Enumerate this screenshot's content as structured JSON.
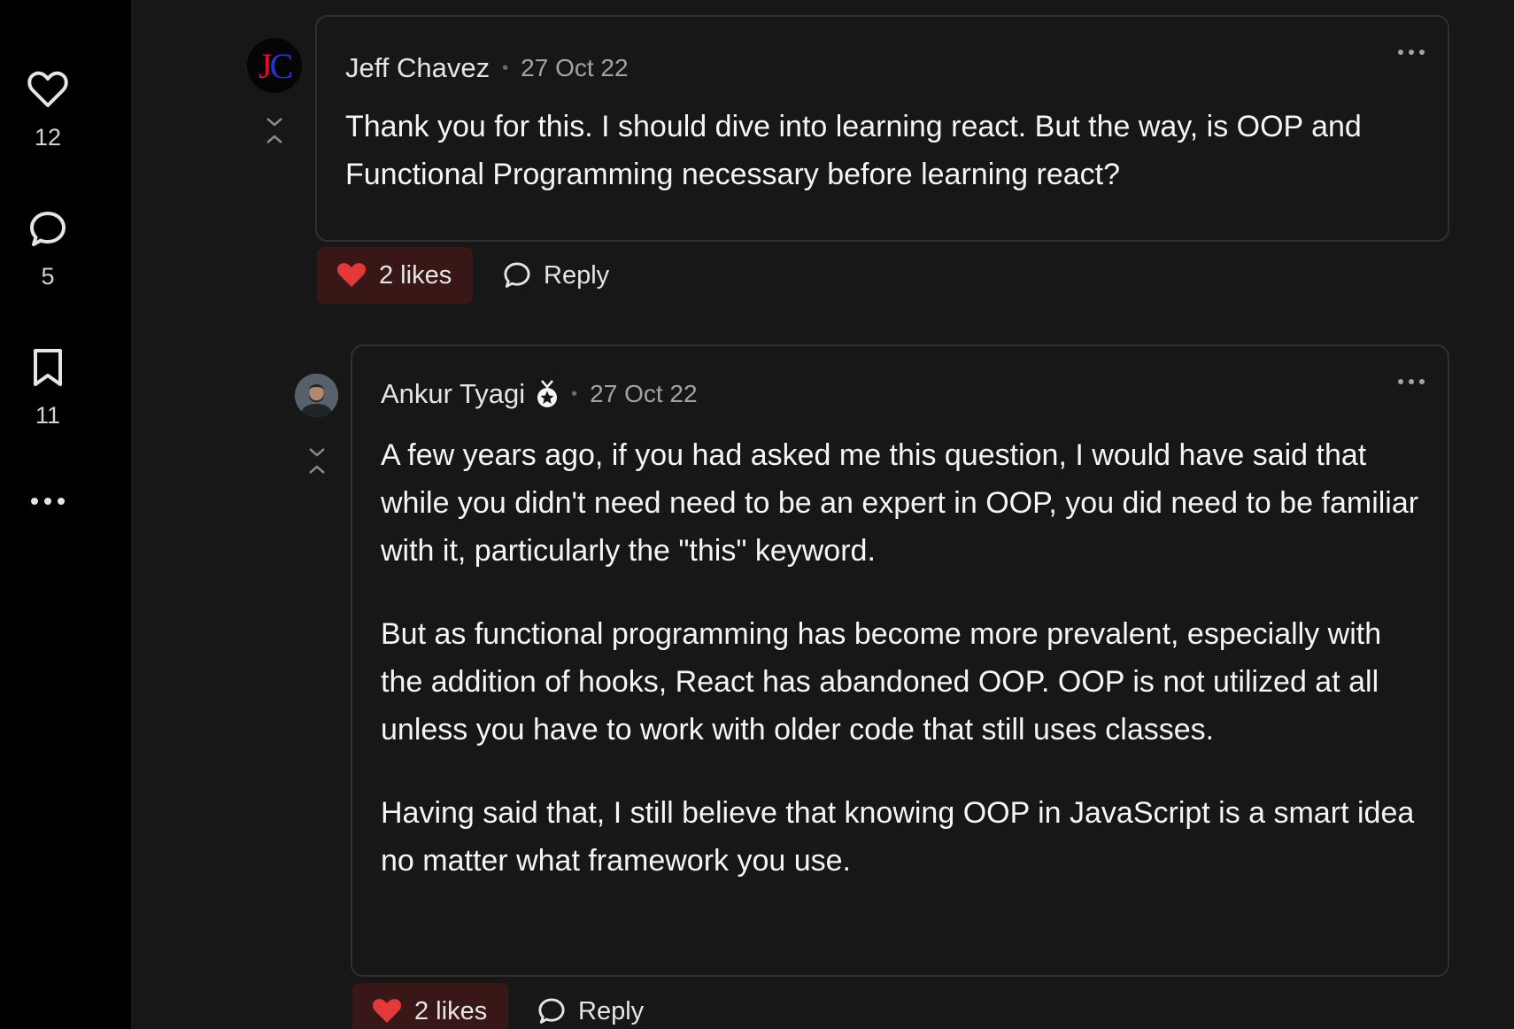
{
  "sidebar": {
    "likes_count": "12",
    "comments_count": "5",
    "bookmarks_count": "11",
    "icons": [
      "heart-icon",
      "comment-icon",
      "bookmark-icon",
      "more-icon"
    ]
  },
  "comments": [
    {
      "avatar_initials_1": "J",
      "avatar_initials_2": "C",
      "author": "Jeff Chavez",
      "date": "27 Oct 22",
      "body": [
        "Thank you for this. I should dive into learning react. But the way, is OOP and Functional Programming necessary before learning react?"
      ],
      "likes_label": "2 likes",
      "reply_label": "Reply"
    },
    {
      "author": "Ankur Tyagi",
      "date": "27 Oct 22",
      "body": [
        "A few years ago, if you had asked me this question, I would have said that while you didn't need need to be an expert in OOP, you did need to be familiar with it, particularly the \"this\" keyword.",
        "But as functional programming has become more prevalent, especially with the addition of hooks, React has abandoned OOP. OOP is not utilized at all unless you have to work with older code that still uses classes.",
        "Having said that, I still believe that knowing OOP in JavaScript is a smart idea no matter what framework you use."
      ],
      "likes_label": "2 likes",
      "reply_label": "Reply"
    }
  ],
  "colors": {
    "background": "#171717",
    "sidebar": "#000000",
    "border": "#303030",
    "like_bg": "#3a1717",
    "heart_red": "#e5383b"
  }
}
